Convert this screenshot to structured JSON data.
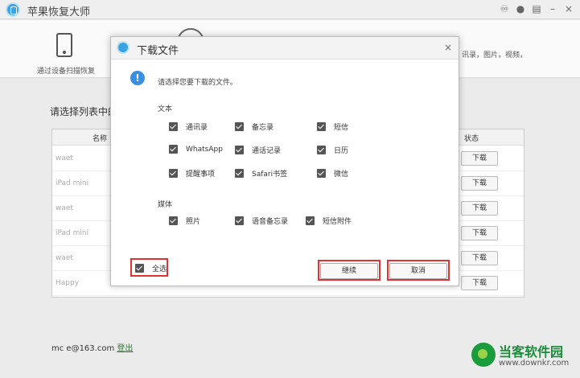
{
  "app": {
    "title": "苹果恢复大师",
    "icons": [
      "weibo-icon",
      "chat-icon",
      "menu-icon",
      "minimize-icon",
      "close-icon"
    ]
  },
  "top": {
    "scan_label": "通过设备扫描恢复",
    "right_hint": "讯录，图片，视频，"
  },
  "main": {
    "list_title": "请选择列表中的",
    "table": {
      "col_name": "名称",
      "col_status": "状态",
      "rows": [
        {
          "name": "waet",
          "action": "下载"
        },
        {
          "name": "iPad mini",
          "action": "下载"
        },
        {
          "name": "waet",
          "action": "下载"
        },
        {
          "name": "iPad mini",
          "action": "下载"
        },
        {
          "name": "waet",
          "action": "下载"
        },
        {
          "name": "Happy",
          "action": "下载"
        }
      ]
    },
    "account": {
      "email": "mc      e@163.com",
      "logout": "登出"
    }
  },
  "dialog": {
    "title": "下载文件",
    "close": "×",
    "prompt": "请选择您要下载的文件。",
    "text_section": "文本",
    "text_items": [
      "通讯录",
      "备忘录",
      "短信",
      "WhatsApp",
      "通话记录",
      "日历",
      "提醒事项",
      "Safari书签",
      "微信"
    ],
    "media_section": "媒体",
    "media_items": [
      "照片",
      "语音备忘录",
      "短信附件"
    ],
    "select_all": "全选",
    "continue": "继续",
    "cancel": "取消"
  },
  "watermark": {
    "name": "当客软件园",
    "url": "www.downkr.com"
  },
  "colors": {
    "accent_blue": "#3aa3e3",
    "highlight_red": "#dd3333",
    "watermark_green": "#1a8c3a"
  }
}
